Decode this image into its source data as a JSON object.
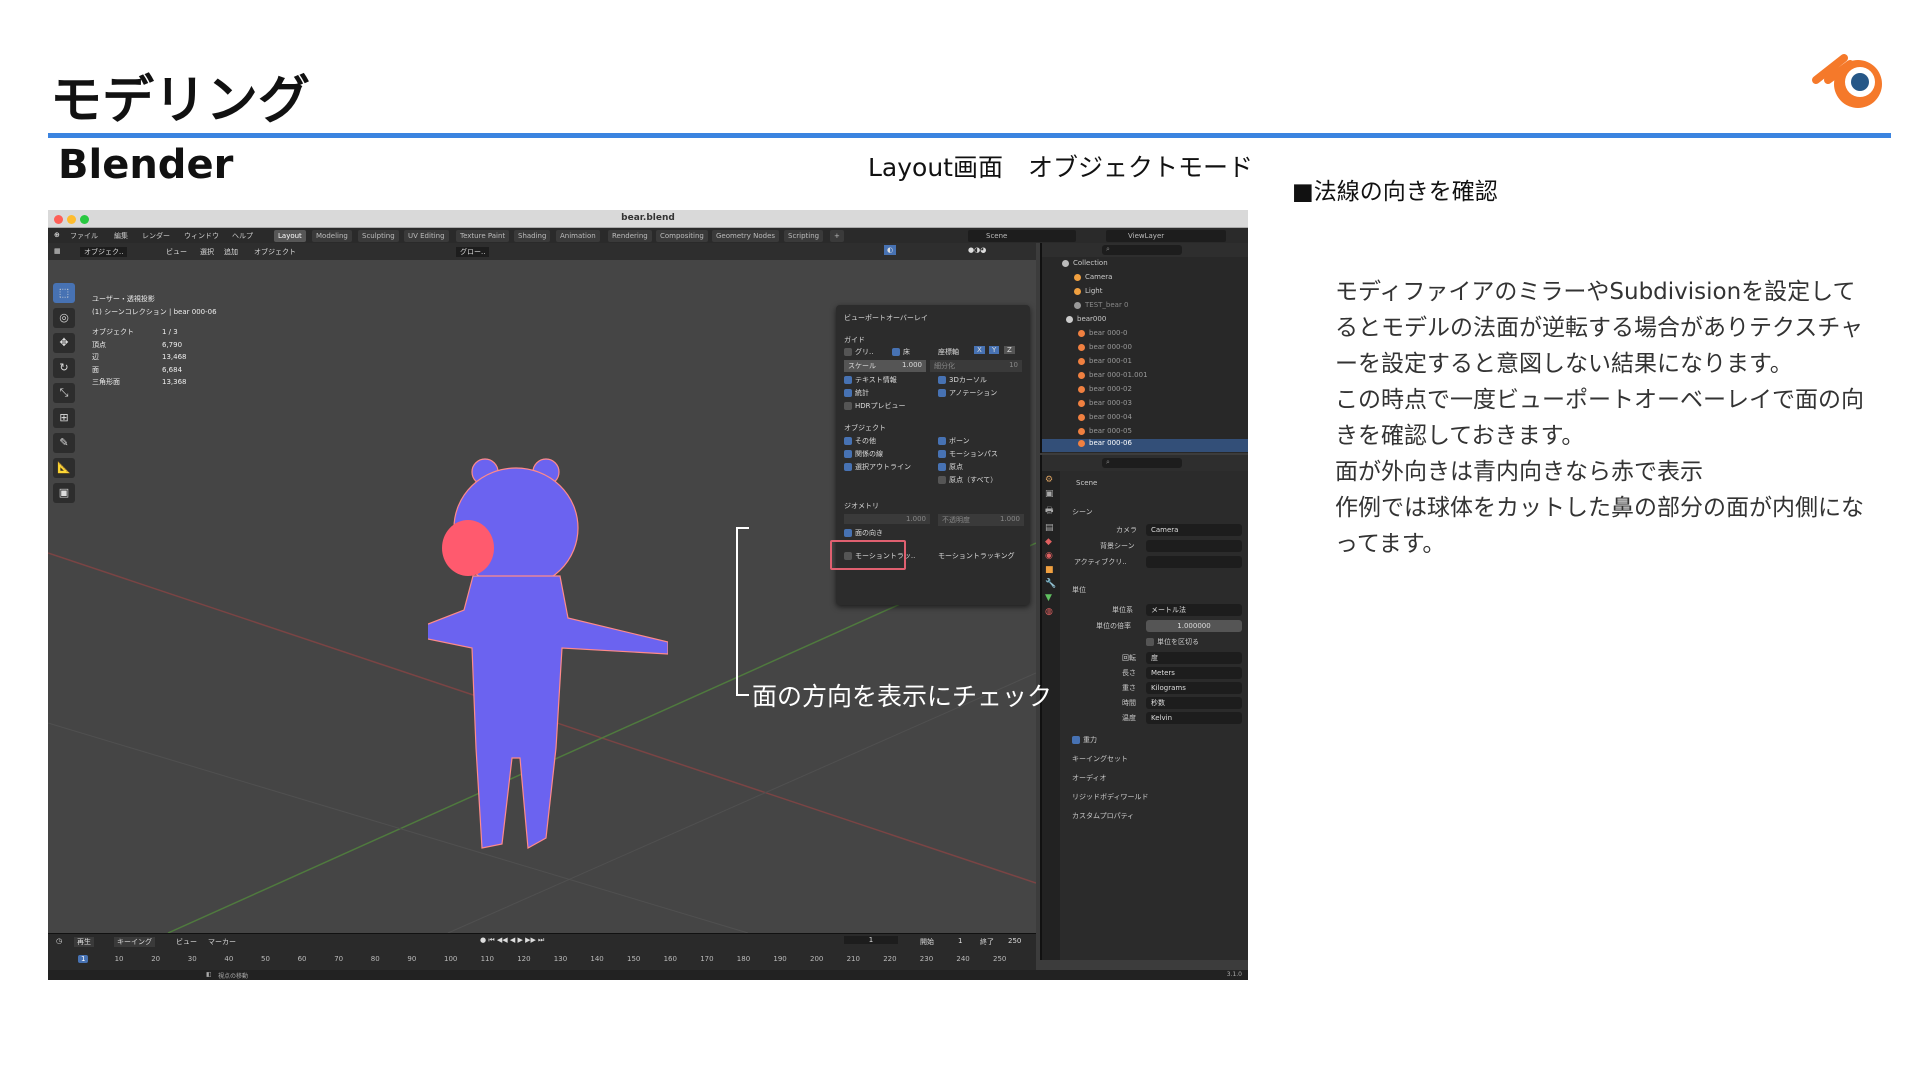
{
  "slide": {
    "title": "モデリング",
    "subtitle": "Blender",
    "mode_label": "Layout画面　オブジェクトモード",
    "section_heading": "■法線の向きを確認",
    "body_lines": [
      "モディファイアのミラーやSubdivisionを設定して",
      "るとモデルの法面が逆転する場合がありテクスチャ",
      "ーを設定すると意図しない結果になります。",
      "この時点で一度ビューポートオーベーレイで面の向",
      "きを確認しておきます。",
      "面が外向きは青内向きなら赤で表示",
      "作例では球体をカットした鼻の部分の面が内側にな",
      "ってます。"
    ],
    "callout": "面の方向を表示にチェック",
    "colors": {
      "accent_rule": "#3b84e0",
      "face_out": "#6b63f0",
      "face_in": "#ff5a6e",
      "blender_orange": "#f5792a",
      "blender_blue": "#265787",
      "highlight": "#e06070"
    }
  },
  "blender": {
    "filename": "bear.blend",
    "menus": [
      "ファイル",
      "編集",
      "レンダー",
      "ウィンドウ",
      "ヘルプ"
    ],
    "workspaces": [
      "Layout",
      "Modeling",
      "Sculpting",
      "UV Editing",
      "Texture Paint",
      "Shading",
      "Animation",
      "Rendering",
      "Compositing",
      "Geometry Nodes",
      "Scripting",
      "+"
    ],
    "active_workspace": "Layout",
    "scene": "Scene",
    "view_layer": "ViewLayer",
    "viewport_header": [
      "オブジェク..",
      "ビュー",
      "選択",
      "追加",
      "オブジェクト",
      "グロー.."
    ],
    "view_info": [
      "ユーザー・透視投影",
      "(1) シーンコレクション | bear 000-06"
    ],
    "stats": [
      {
        "label": "オブジェクト",
        "value": "1 / 3"
      },
      {
        "label": "頂点",
        "value": "6,790"
      },
      {
        "label": "辺",
        "value": "13,468"
      },
      {
        "label": "面",
        "value": "6,684"
      },
      {
        "label": "三角形面",
        "value": "13,368"
      }
    ],
    "overlay": {
      "title": "ビューポートオーバーレイ",
      "guides_heading": "ガイド",
      "grid": "グリ..",
      "floor": "床",
      "axes": "座標軸",
      "axis_x": "X",
      "axis_y": "Y",
      "axis_z": "Z",
      "scale_label": "スケール",
      "scale_value": "1.000",
      "subdiv_label": "細分化",
      "subdiv_value": "10",
      "text_info": "テキスト情報",
      "cursor3d": "3Dカーソル",
      "statistics": "統計",
      "annotations": "アノテーション",
      "hdr": "HDRプレビュー",
      "objects_heading": "オブジェクト",
      "extras": "その他",
      "bones": "ボーン",
      "relations": "関係の線",
      "motion_paths": "モーションパス",
      "outline": "選択アウトライン",
      "origins": "原点",
      "origins_all": "原点（すべて）",
      "geometry_heading": "ジオメトリ",
      "wireframe_value": "1.000",
      "fade_label": "不透明度",
      "fade_value": "1.000",
      "face_orientation": "面の向き",
      "motion_tracking": "モーショントラッ..",
      "motion_tracking2": "モーショントラッキング"
    },
    "outliner": [
      {
        "name": "Collection",
        "color": "#bbbbbb"
      },
      {
        "name": "Camera",
        "color": "#f0a040"
      },
      {
        "name": "Light",
        "color": "#f0a040"
      },
      {
        "name": "TEST_bear 0",
        "color": "#999999"
      },
      {
        "name": "bear000",
        "color": "#cccccc"
      },
      {
        "name": "bear 000-0",
        "color": "#f08040"
      },
      {
        "name": "bear 000-00",
        "color": "#f08040"
      },
      {
        "name": "bear 000-01",
        "color": "#f08040"
      },
      {
        "name": "bear 000-01.001",
        "color": "#f08040"
      },
      {
        "name": "bear 000-02",
        "color": "#f08040"
      },
      {
        "name": "bear 000-03",
        "color": "#f08040"
      },
      {
        "name": "bear 000-04",
        "color": "#f08040"
      },
      {
        "name": "bear 000-05",
        "color": "#f08040"
      },
      {
        "name": "bear 000-06",
        "color": "#f08040"
      }
    ],
    "properties": {
      "scene_name": "Scene",
      "scene_heading": "シーン",
      "camera_label": "カメラ",
      "camera_value": "Camera",
      "bg_scene_label": "背景シーン",
      "active_clip_label": "アクティブクリ..",
      "units_heading": "単位",
      "unit_system_label": "単位系",
      "unit_system_value": "メートル法",
      "unit_scale_label": "単位の倍率",
      "unit_scale_value": "1.000000",
      "separate_units": "単位を区切る",
      "rotation_label": "回転",
      "rotation_value": "度",
      "length_label": "長さ",
      "length_value": "Meters",
      "mass_label": "重さ",
      "mass_value": "Kilograms",
      "time_label": "時間",
      "time_value": "秒数",
      "temp_label": "温度",
      "temp_value": "Kelvin",
      "gravity": "重力",
      "keying_sets": "キーイングセット",
      "audio": "オーディオ",
      "rigid_body": "リジッドボディワールド",
      "custom_props": "カスタムプロパティ"
    },
    "timeline": {
      "play_menu": "再生",
      "keying_menu": "キーイング",
      "view_menu": "ビュー",
      "marker_menu": "マーカー",
      "current_frame": "1",
      "start_label": "開始",
      "start_value": "1",
      "end_label": "終了",
      "end_value": "250",
      "ticks": [
        "1",
        "10",
        "20",
        "30",
        "40",
        "50",
        "60",
        "70",
        "80",
        "90",
        "100",
        "110",
        "120",
        "130",
        "140",
        "150",
        "160",
        "170",
        "180",
        "190",
        "200",
        "210",
        "220",
        "230",
        "240",
        "250"
      ]
    },
    "status_center": "視点の移動",
    "version": "3.1.0"
  }
}
